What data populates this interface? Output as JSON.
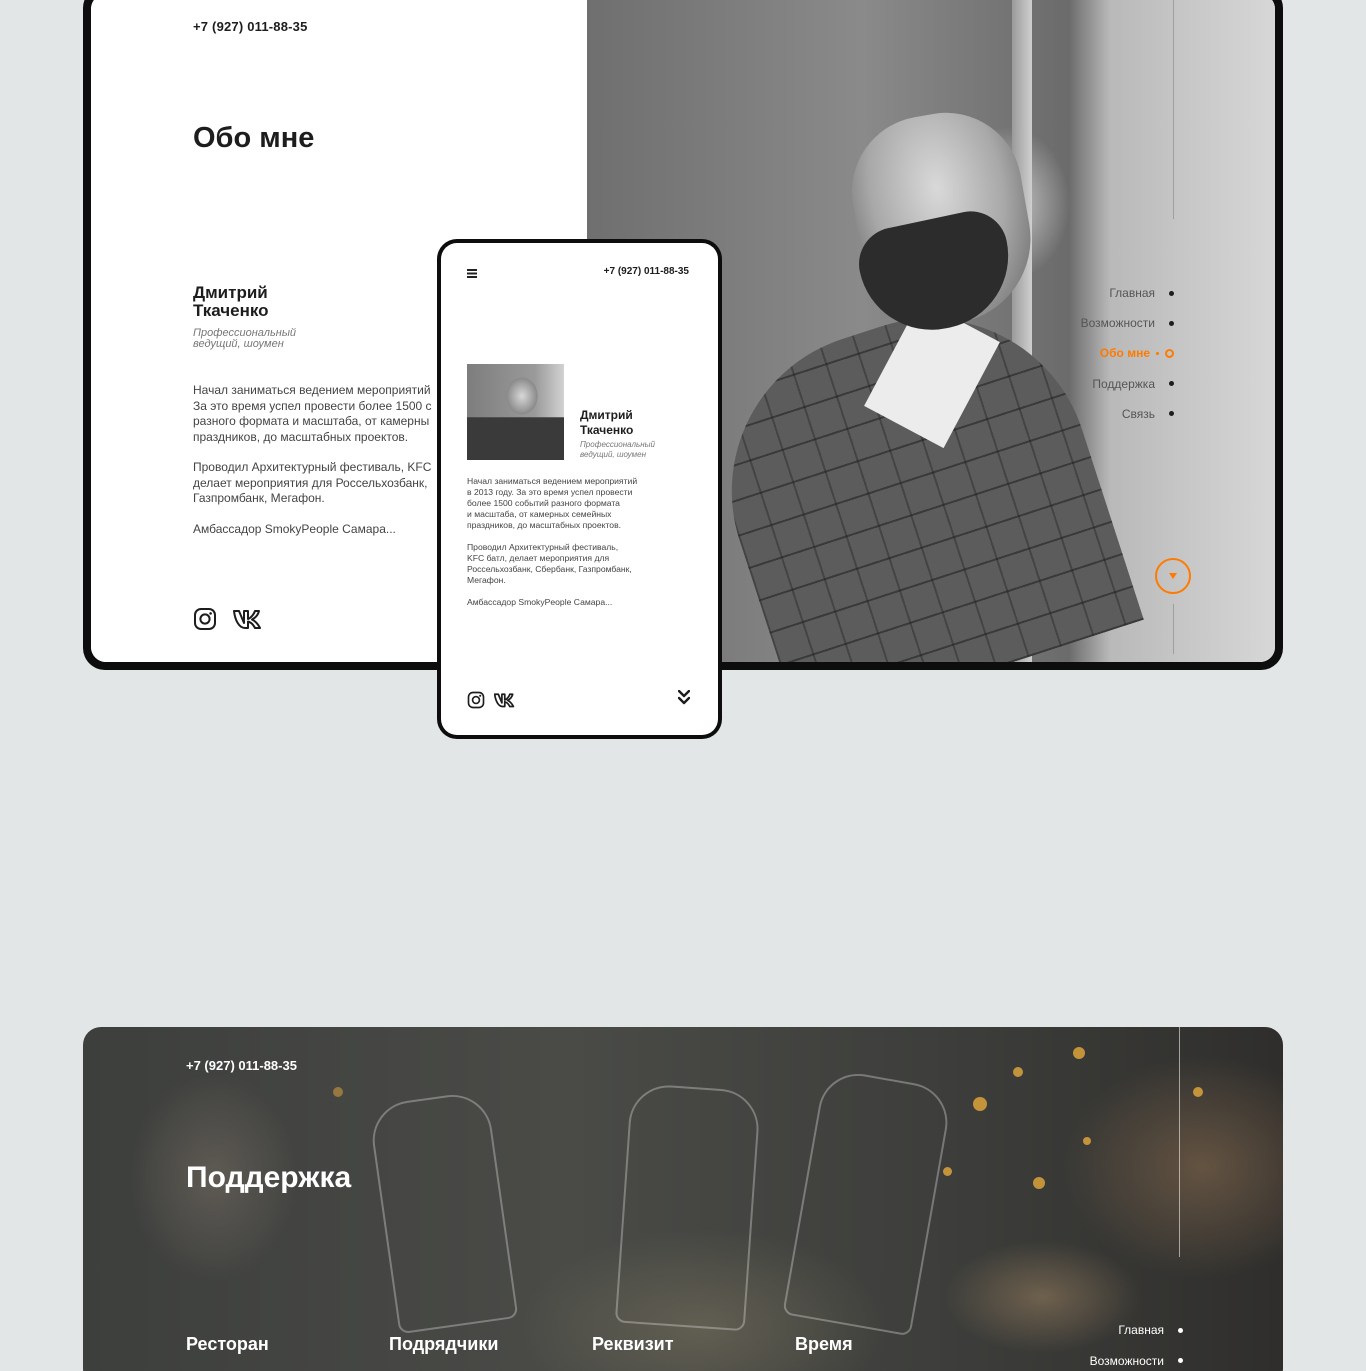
{
  "desktop": {
    "phone": "+7 (927) 011-88-35",
    "title": "Обо мне",
    "name": "Дмитрий Ткаченко",
    "role": "Профессиональный ведущий, шоумен",
    "paragraphs": [
      "Начал заниматься ведением мероприятий\nЗа это время успел провести более 1500 с\nразного формата и масштаба, от камерны\nпраздников, до масштабных проектов.",
      "Проводил Архитектурный фестиваль, KFC\nделает мероприятия для Россельхозбанк,\nГазпромбанк, Мегафон.",
      "Амбассадор SmokyPeople Самара..."
    ],
    "nav": [
      {
        "label": "Главная",
        "active": false
      },
      {
        "label": "Возможности",
        "active": false
      },
      {
        "label": "Обо мне",
        "active": true
      },
      {
        "label": "Поддержка",
        "active": false
      },
      {
        "label": "Связь",
        "active": false
      }
    ],
    "accent_color": "#ff7a00",
    "icons": [
      "instagram-icon",
      "vk-icon",
      "scroll-down-icon"
    ]
  },
  "mobile": {
    "phone": "+7 (927) 011-88-35",
    "name": "Дмитрий Ткаченко",
    "role": "Профессиональный ведущий, шоумен",
    "paragraphs": [
      "Начал заниматься ведением мероприятий\nв 2013 году. За это время успел провести\nболее 1500 событий разного формата\nи масштаба, от камерных семейных\nпраздников, до масштабных проектов.",
      "Проводил Архитектурный фестиваль,\nKFC батл, делает мероприятия для\nРоссельхозбанк, Сбербанк, Газпромбанк,\nМегафон.",
      "Амбассадор SmokyPeople Самара..."
    ],
    "icons": [
      "menu-icon",
      "instagram-icon",
      "vk-icon",
      "double-chevron-down-icon"
    ]
  },
  "support": {
    "phone": "+7 (927) 011-88-35",
    "title": "Поддержка",
    "categories": [
      "Ресторан",
      "Подрядчики",
      "Реквизит",
      "Время"
    ],
    "nav": [
      "Главная",
      "Возможности"
    ]
  }
}
